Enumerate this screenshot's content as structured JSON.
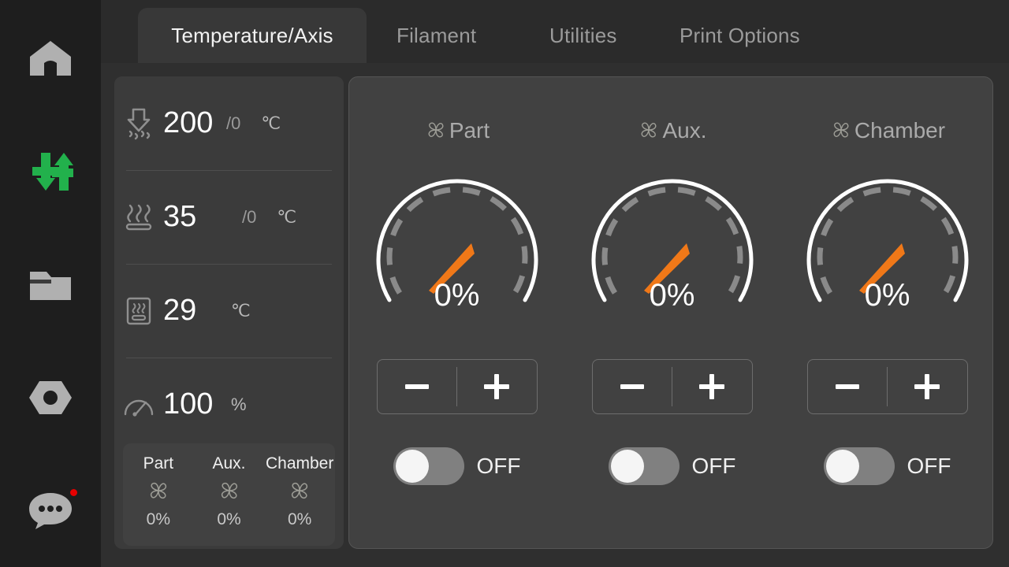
{
  "sidebar": {
    "items": [
      {
        "name": "home",
        "icon": "home-icon",
        "active": false,
        "badge": false
      },
      {
        "name": "controls",
        "icon": "sliders-icon",
        "active": true,
        "badge": false
      },
      {
        "name": "files",
        "icon": "folder-icon",
        "active": false,
        "badge": false
      },
      {
        "name": "settings",
        "icon": "nut-icon",
        "active": false,
        "badge": false
      },
      {
        "name": "console",
        "icon": "chat-bubble-icon",
        "active": false,
        "badge": true
      }
    ],
    "active_color": "#22b14c",
    "idle_color": "#b0b0b0",
    "badge_color": "#e60000"
  },
  "tabs": [
    {
      "label": "Temperature/Axis",
      "active": true
    },
    {
      "label": "Filament",
      "active": false
    },
    {
      "label": "Utilities",
      "active": false
    },
    {
      "label": "Print Options",
      "active": false
    }
  ],
  "status_rows": [
    {
      "icon": "nozzle-icon",
      "value": "200",
      "target": "/0",
      "unit": "℃"
    },
    {
      "icon": "bed-icon",
      "value": "35",
      "target": "/0",
      "unit": "℃"
    },
    {
      "icon": "chamber-icon",
      "value": "29",
      "target": "",
      "unit": "℃"
    },
    {
      "icon": "speedometer-icon",
      "value": "100",
      "target": "",
      "unit": "%"
    }
  ],
  "fan_summary": {
    "items": [
      {
        "label": "Part",
        "percent": "0%",
        "icon": "fan-icon"
      },
      {
        "label": "Aux.",
        "percent": "0%",
        "icon": "fan-icon"
      },
      {
        "label": "Chamber",
        "percent": "0%",
        "icon": "fan-icon"
      }
    ]
  },
  "fan_controls": {
    "decrease_label": "−",
    "increase_label": "+",
    "fans": [
      {
        "title": "Part",
        "icon": "fan-icon",
        "value": "0%",
        "percent": 0,
        "toggle_state": "OFF",
        "toggle_on": false
      },
      {
        "title": "Aux.",
        "icon": "fan-icon",
        "value": "0%",
        "percent": 0,
        "toggle_state": "OFF",
        "toggle_on": false
      },
      {
        "title": "Chamber",
        "icon": "fan-icon",
        "value": "0%",
        "percent": 0,
        "toggle_state": "OFF",
        "toggle_on": false
      }
    ]
  },
  "colors": {
    "needle": "#f07818",
    "gauge_arc": "#ffffff",
    "gauge_ticks": "#8a8a8a",
    "panel_bg": "#414141",
    "sidebar_bg": "#1e1e1e",
    "accent_green": "#22b14c"
  }
}
